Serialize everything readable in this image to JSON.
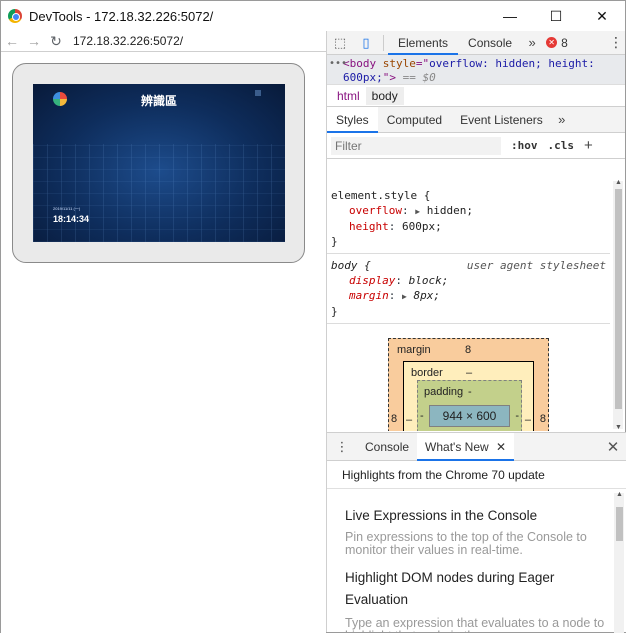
{
  "window": {
    "title": "DevTools - 172.18.32.226:5072/",
    "buttons": {
      "minimize": "—",
      "maximize": "☐",
      "close": "✕"
    }
  },
  "browser": {
    "url": "172.18.32.226:5072/",
    "icons": {
      "back": "back-arrow-icon",
      "forward": "forward-arrow-icon",
      "reload": "reload-icon"
    },
    "screen": {
      "title": "辨識區",
      "date": "2019/11/11 (一)",
      "time": "18:14:34"
    }
  },
  "devtools": {
    "main_tabs": [
      "Elements",
      "Console"
    ],
    "selected_main_tab": "Elements",
    "error_count": "8",
    "dom_line": {
      "tag_open": "<body ",
      "attr_name": "style",
      "attr_eq": "=\"",
      "attr_value": "overflow: hidden; height: 600px;",
      "tag_close": "\">",
      "eq_marker": " == $0"
    },
    "breadcrumbs": [
      "html",
      "body"
    ],
    "style_tabs": [
      "Styles",
      "Computed",
      "Event Listeners"
    ],
    "filter": {
      "placeholder": "Filter",
      "hov": ":hov",
      "cls": ".cls",
      "add": "+"
    },
    "rules": [
      {
        "selector": "element.style {",
        "props": [
          {
            "name": "overflow",
            "value": "hidden;",
            "has_triangle": true
          },
          {
            "name": "height",
            "value": "600px;",
            "has_triangle": false
          }
        ],
        "close": "}"
      },
      {
        "selector": "body {",
        "source": "user agent stylesheet",
        "props": [
          {
            "name": "display",
            "value": "block;",
            "has_triangle": false
          },
          {
            "name": "margin",
            "value": "8px;",
            "has_triangle": true
          }
        ],
        "close": "}"
      }
    ],
    "box_model": {
      "margin_label": "margin",
      "margin_top": "8",
      "margin_left": "8",
      "margin_right": "8",
      "border_label": "border",
      "border_top": "–",
      "border_left": "–",
      "border_right": "–",
      "padding_label": "padding",
      "padding_top": "-",
      "padding_left": "-",
      "padding_right": "-",
      "padding_bottom": "–",
      "content": "944 × 600"
    },
    "drawer": {
      "tabs": [
        "Console",
        "What's New"
      ],
      "selected_tab": "What's New",
      "header": "Highlights from the Chrome 70 update",
      "items": [
        {
          "title": "Live Expressions in the Console",
          "desc": "Pin expressions to the top of the Console to monitor their values in real-time."
        },
        {
          "title": "Highlight DOM nodes during Eager Evaluation",
          "desc": "Type an expression that evaluates to a node to highlight that node in the"
        }
      ]
    }
  }
}
